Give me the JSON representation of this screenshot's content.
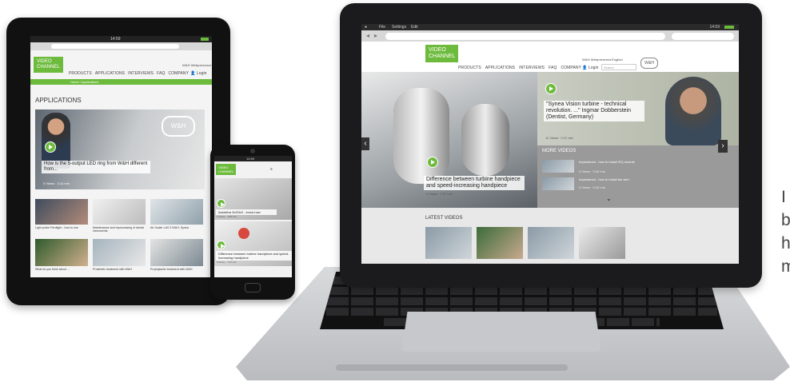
{
  "laptop": {
    "os_menu": [
      "File",
      "Settings",
      "Edit"
    ],
    "clock": "14:59",
    "brand_line1": "VIDEO",
    "brand_line2": "CHANNEL",
    "nav": [
      "PRODUCTS",
      "APPLICATIONS",
      "INTERVIEWS",
      "FAQ",
      "COMPANY"
    ],
    "top_link": "W&H Webpresence",
    "language": "English",
    "login": "Login",
    "search_placeholder": "Search",
    "logo": "W&H",
    "hero_quote": "\"Synea Vision turbine - technical revolution. ...\" Ingmar Dobberstein (Dentist, Germany)",
    "hero_quote_meta": "11 Views · 0:27 min",
    "hero_caption": "Difference between turbine handpiece and speed-increasing handpiece",
    "hero_caption_meta": "0 Views · 7:37 min",
    "more_videos_title": "MORE VIDEOS",
    "more_videos": [
      {
        "title": "Implantmed - how to install ISQ module",
        "meta": "0 Views · 0:49 min"
      },
      {
        "title": "Implantmed - how to install the wire",
        "meta": "0 Views · 0:43 min"
      }
    ],
    "latest_title": "LATEST VIDEOS",
    "thumb_logo": "W&H",
    "arrow_left": "‹",
    "arrow_right": "›",
    "chevron_down": "⌄"
  },
  "tablet": {
    "clock": "14:59",
    "brand_line1": "VIDEO",
    "brand_line2": "CHANNEL",
    "nav": [
      "PRODUCTS",
      "APPLICATIONS",
      "INTERVIEWS",
      "FAQ",
      "COMPANY"
    ],
    "top_link": "W&H Webpresence",
    "login": "Login",
    "breadcrumb": "Home / Applications",
    "section_title": "APPLICATIONS",
    "hero_caption": "How is the 5-output LED ring from W&H different from...",
    "hero_meta": "0 Views · 3:14 min",
    "hero_logo": "W&H",
    "thumbs": [
      {
        "title": "Light probe Flexilight - how to use",
        "meta": "0 Views · 1:02 min"
      },
      {
        "title": "Maintenance and reprocessing of dental instruments",
        "meta": "0 Views · 3:41 min"
      },
      {
        "title": "Air Scaler LAS 3 W&H, Synea",
        "meta": "0 Views · 2:11 min"
      },
      {
        "title": "What do you think about ...",
        "meta": "0 Views · 2:27 min"
      },
      {
        "title": "Prosthetic treatment with W&H",
        "meta": "0 Views · 4:05 min"
      },
      {
        "title": "Prophylactic treatment with W&H",
        "meta": "0 Views · 2:51 min"
      }
    ]
  },
  "phone": {
    "clock": "14:59",
    "brand_line1": "VIDEO",
    "brand_line2": "CHANNEL",
    "caption1": "Assistina 3x3/3x2 - know-how",
    "caption1_meta": "0 Views · 4:05 min",
    "caption2": "Difference between turbine handpiece and speed-increasing handpiece",
    "caption2_meta": "0 Views · 7:37 min"
  },
  "side_text": [
    "I",
    "b",
    "h",
    "m"
  ],
  "colors": {
    "accent": "#6dbb3c",
    "device": "#111111",
    "laptop_silver": "#c9cbce"
  }
}
